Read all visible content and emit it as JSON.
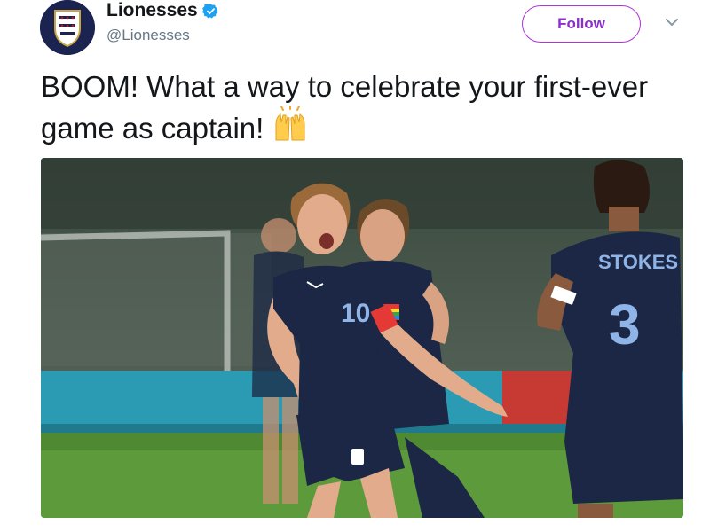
{
  "account": {
    "display_name": "Lionesses",
    "handle": "@Lionesses",
    "verified": true,
    "avatar_icon": "england-crest-icon"
  },
  "actions": {
    "follow_label": "Follow",
    "menu_icon": "chevron-down-icon"
  },
  "tweet": {
    "text": "BOOM! What a way to celebrate your first-ever game as captain!",
    "emoji_icon": "raised-hands-emoji"
  },
  "photo": {
    "jersey_number_front": "10",
    "jersey_name_back": "STOKES",
    "jersey_number_back": "3"
  },
  "colors": {
    "follow_accent": "#b033d8",
    "verified_blue": "#1da1f2",
    "kit_navy": "#1b2744"
  }
}
